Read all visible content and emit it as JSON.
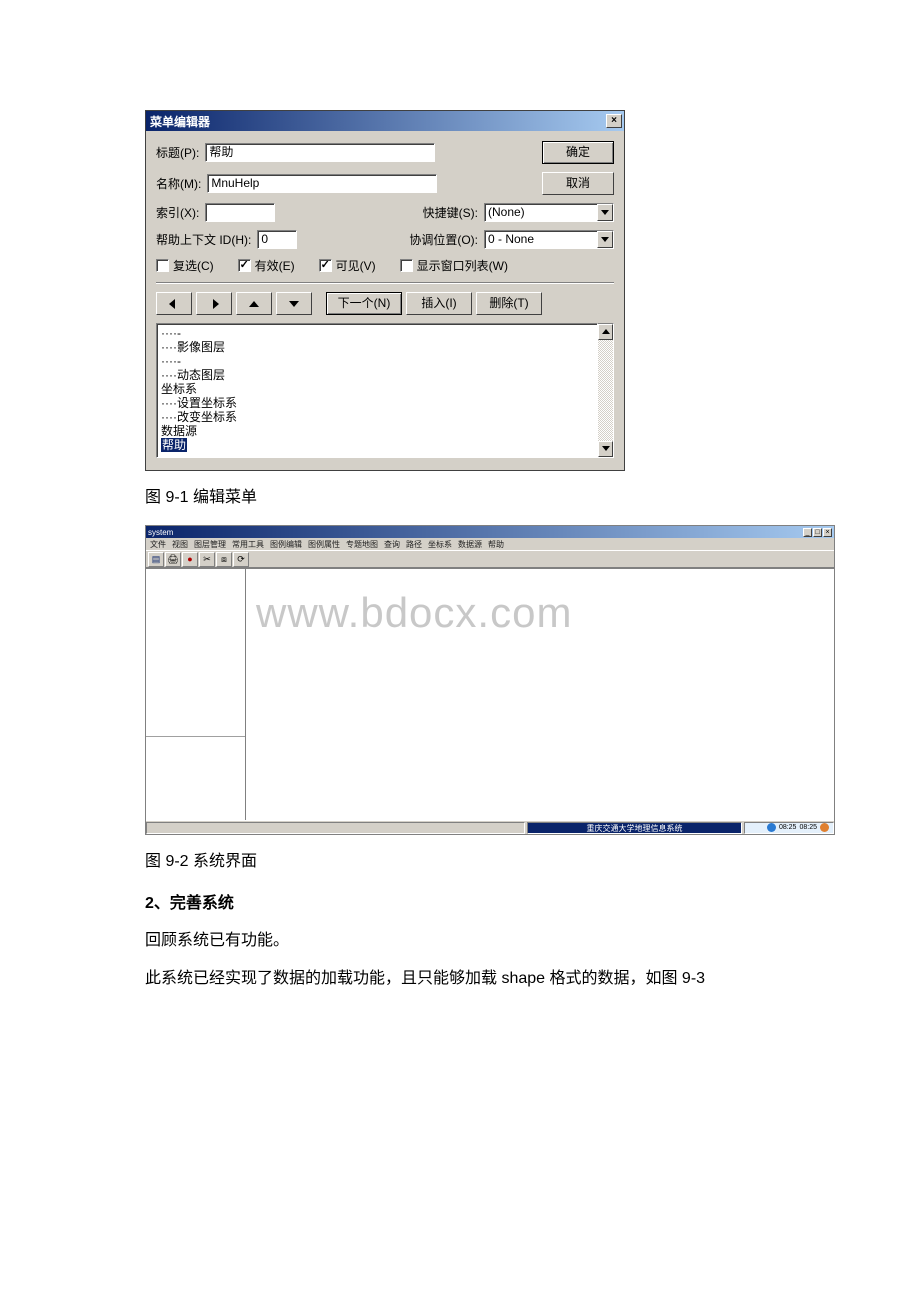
{
  "fig91": {
    "titlebar": "菜单编辑器",
    "close_glyph": "×",
    "labels": {
      "caption": "标题(P):",
      "name": "名称(M):",
      "index": "索引(X):",
      "shortcut": "快捷键(S):",
      "help_ctx": "帮助上下文 ID(H):",
      "negotiate": "协调位置(O):",
      "checked": "复选(C)",
      "enabled": "有效(E)",
      "visible": "可见(V)",
      "window_list": "显示窗口列表(W)"
    },
    "fields": {
      "caption_value": "帮助",
      "name_value": "MnuHelp",
      "index_value": "",
      "help_ctx_value": "0",
      "shortcut_combo": "(None)",
      "negotiate_combo": "0 - None"
    },
    "checks": {
      "checked": false,
      "enabled": true,
      "visible": true,
      "window_list": false
    },
    "buttons": {
      "ok": "确定",
      "cancel": "取消",
      "next": "下一个(N)",
      "insert": "插入(I)",
      "delete": "删除(T)"
    },
    "list": {
      "dots": "····",
      "sep": "-",
      "image_layer": "影像图层",
      "dynamic_layer": "动态图层",
      "coord_sys": "坐标系",
      "set_coord": "设置坐标系",
      "change_coord": "改变坐标系",
      "data_source": "数据源",
      "help_selected": "帮助"
    }
  },
  "caption91": "图 9-1 编辑菜单",
  "fig92": {
    "title": "system",
    "menus": [
      "文件",
      "视图",
      "图层管理",
      "常用工具",
      "图例编辑",
      "图例属性",
      "专题地图",
      "查询",
      "路径",
      "坐标系",
      "数据源",
      "帮助"
    ],
    "toolbar_icons": [
      "tool-a",
      "tool-b",
      "tool-c",
      "tool-d",
      "tool-e",
      "tool-f"
    ],
    "watermark": "www.bdocx.com",
    "status_mid": "重庆交通大学地理信息系统",
    "tray_time1": "08:25",
    "tray_time2": "08:25"
  },
  "caption92": "图 9-2 系统界面",
  "heading2": "2、完善系统",
  "para1": " 回顾系统已有功能。",
  "para2": "此系统已经实现了数据的加载功能，且只能够加载 shape 格式的数据，如图 9-3"
}
